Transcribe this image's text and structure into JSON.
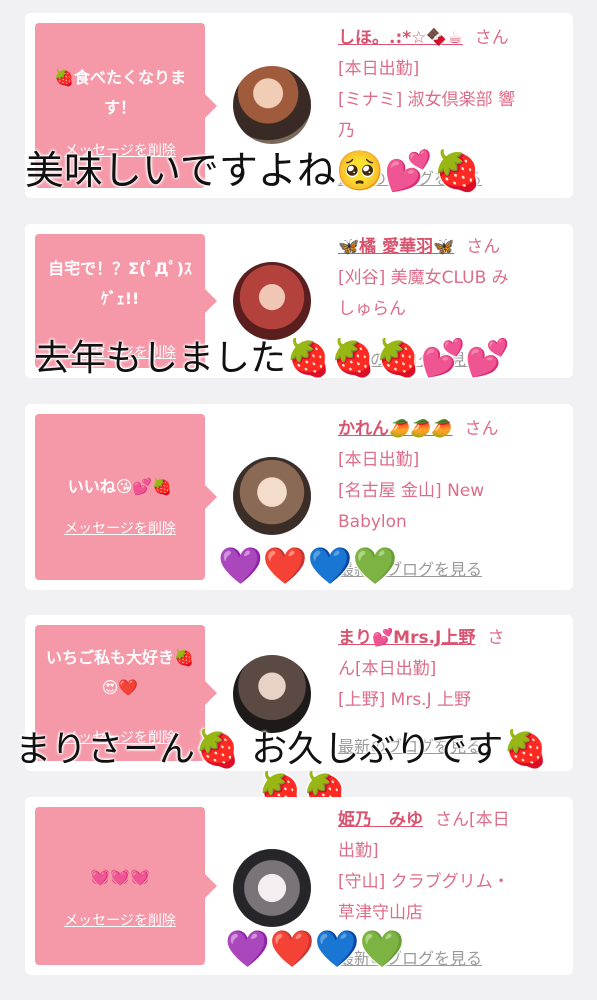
{
  "cards": [
    {
      "message": "🍓食べたくなります！",
      "delete_label": "メッセージを削除",
      "name": "しほ。.:*☆🍫☕",
      "san": "さん",
      "status": "[本日出勤]",
      "shop": "[ミナミ] 淑女倶楽部 響",
      "shop_cont": "乃",
      "blog_link": "最新のブログを見る",
      "overlay": "美味しいですよね🥺💕🍓"
    },
    {
      "message": "自宅で！？Σ(ﾟДﾟ)ｽｹﾞｪ!!",
      "delete_label": "メッセージを削除",
      "name": "🦋橘 愛華羽🦋",
      "san": "さん",
      "status": "",
      "shop": "[刈谷] 美魔女CLUB み",
      "shop_cont": "しゅらん",
      "blog_link": "最新のブログを見る",
      "overlay": "去年もしました🍓🍓🍓💕💕"
    },
    {
      "message": "いいね😘💕🍓",
      "delete_label": "メッセージを削除",
      "name": "かれん🥭🥭🥭",
      "san": "さん",
      "status": "[本日出勤]",
      "shop": "[名古屋 金山] New",
      "shop_cont": "Babylon",
      "blog_link": "最新のブログを見る",
      "overlay": "💜❤️💙💚"
    },
    {
      "message": "いちご私も大好き🍓😍❤️",
      "delete_label": "メッセージを削除",
      "name": "まり💕Mrs.J上野",
      "san": "さ",
      "status": "ん[本日出勤]",
      "shop": "[上野] Mrs.J 上野",
      "shop_cont": "",
      "blog_link": "最新のブログを見る",
      "overlay": "まりさーん🍓 お久しぶりです🍓",
      "overlay2": "🍓🍓"
    },
    {
      "message": "💓💓💓",
      "delete_label": "メッセージを削除",
      "name": "姫乃　みゆ",
      "san": "さん[本日",
      "status": "出勤]",
      "shop": "[守山] クラブグリム・",
      "shop_cont": "草津守山店",
      "blog_link": "最新のブログを見る",
      "overlay": "💜❤️💙💚"
    }
  ],
  "colors": {
    "bubble": "#f598a8",
    "name": "#d9536f",
    "text": "#dd6d88",
    "link": "#9a9a9a",
    "background": "#f1f1f3"
  }
}
